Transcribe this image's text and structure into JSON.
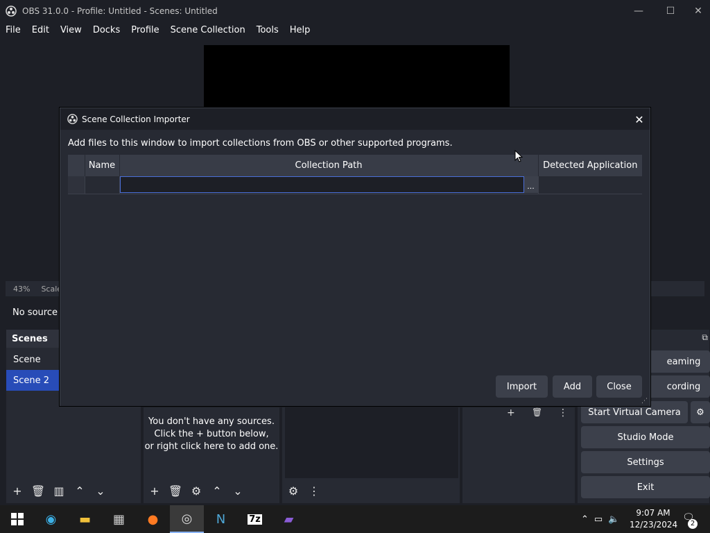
{
  "obs": {
    "title": "OBS 31.0.0 - Profile: Untitled - Scenes: Untitled",
    "menu": [
      "File",
      "Edit",
      "View",
      "Docks",
      "Profile",
      "Scene Collection",
      "Tools",
      "Help"
    ],
    "zoom": "43%",
    "scale_text": "Scale t",
    "no_source": "No source s",
    "scenes": {
      "title": "Scenes",
      "items": [
        "Scene",
        "Scene 2"
      ],
      "selected": "Scene 2"
    },
    "sources_empty": [
      "You don't have any sources.",
      "Click the + button below,",
      "or right click here to add one."
    ],
    "controls": {
      "streaming": "eaming",
      "recording": "cording",
      "virtual_camera": "Start Virtual Camera",
      "studio_mode": "Studio Mode",
      "settings": "Settings",
      "exit": "Exit"
    }
  },
  "dialog": {
    "title": "Scene Collection Importer",
    "description": "Add files to this window to import collections from OBS or other supported programs.",
    "columns": [
      "Name",
      "Collection Path",
      "Detected Application"
    ],
    "browse_label": "...",
    "buttons": {
      "import": "Import",
      "add": "Add",
      "close": "Close"
    }
  },
  "taskbar": {
    "time": "9:07 AM",
    "date": "12/23/2024",
    "notifications": "2"
  },
  "colors": {
    "accent": "#284cb8",
    "panel": "#272a33",
    "background": "#1d1f26",
    "button": "#3c404b"
  }
}
